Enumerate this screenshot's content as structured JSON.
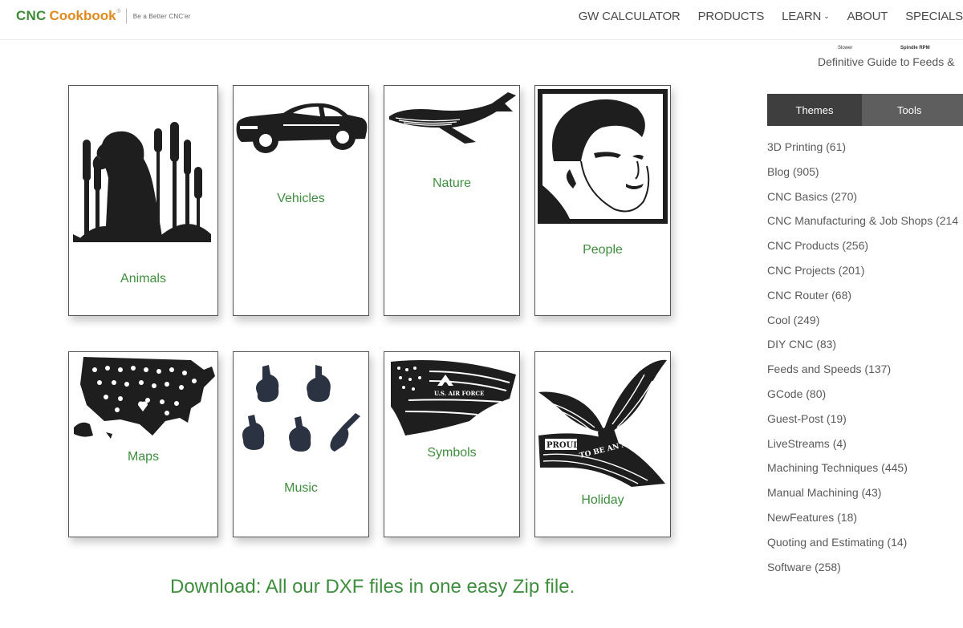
{
  "header": {
    "logo_cnc": "CNC",
    "logo_cookbook": "Cookbook",
    "logo_reg": "®",
    "logo_tagline": "Be a Better CNC'er",
    "nav": [
      {
        "label": "GW CALCULATOR"
      },
      {
        "label": "PRODUCTS"
      },
      {
        "label": "LEARN"
      },
      {
        "label": "ABOUT"
      },
      {
        "label": "SPECIALS"
      }
    ]
  },
  "sidebar": {
    "chart_label_left": "Slower",
    "chart_label_right": "Spindle RPM",
    "guide_link": "Definitive Guide to Feeds &",
    "tabs": [
      {
        "label": "Themes",
        "active": true
      },
      {
        "label": "Tools",
        "active": false
      }
    ],
    "categories": [
      {
        "label": "3D Printing (61)"
      },
      {
        "label": "Blog (905)"
      },
      {
        "label": "CNC Basics (270)"
      },
      {
        "label": "CNC Manufacturing & Job Shops (214"
      },
      {
        "label": "CNC Products (256)"
      },
      {
        "label": "CNC Projects (201)"
      },
      {
        "label": "CNC Router (68)"
      },
      {
        "label": "Cool (249)"
      },
      {
        "label": "DIY CNC (83)"
      },
      {
        "label": "Feeds and Speeds (137)"
      },
      {
        "label": "GCode (80)"
      },
      {
        "label": "Guest-Post (19)"
      },
      {
        "label": "LiveStreams (4)"
      },
      {
        "label": "Machining Techniques (445)"
      },
      {
        "label": "Manual Machining (43)"
      },
      {
        "label": "NewFeatures (18)"
      },
      {
        "label": "Quoting and Estimating (14)"
      },
      {
        "label": "Software (258)"
      }
    ]
  },
  "gallery": {
    "cards": [
      {
        "label": "Animals",
        "icon": "dog-cattails-icon"
      },
      {
        "label": "Vehicles",
        "icon": "muscle-car-icon"
      },
      {
        "label": "Nature",
        "icon": "whale-icon"
      },
      {
        "label": "People",
        "icon": "portrait-icon"
      },
      {
        "label": "Maps",
        "icon": "usa-map-icon"
      },
      {
        "label": "Music",
        "icon": "guitars-icon"
      },
      {
        "label": "Symbols",
        "icon": "air-force-flag-icon"
      },
      {
        "label": "Holiday",
        "icon": "eagle-flag-icon"
      }
    ],
    "flag_text": "U.S. AIR FORCE",
    "banner_text_left": "PROUD",
    "banner_text_right": "TO BE AN AMERICAN"
  },
  "download_text": "Download: All our DXF files in one easy Zip file.",
  "colors": {
    "green": "#3e8e3e",
    "orange": "#e08a1e",
    "tab_active": "#3e3e3e",
    "tab_inactive": "#5e5e5e",
    "silhouette": "#1e1e1e",
    "guitar": "#2b3342"
  }
}
